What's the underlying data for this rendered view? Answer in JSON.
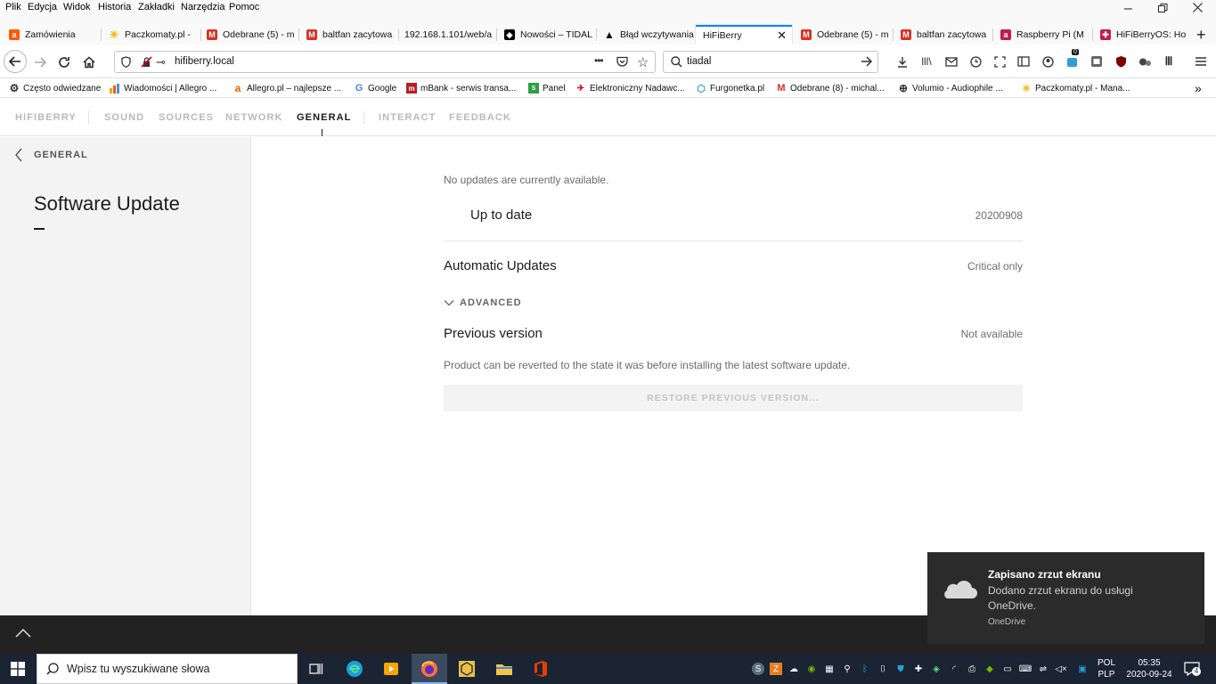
{
  "menubar": {
    "items": [
      "Plik",
      "Edycja",
      "Widok",
      "Historia",
      "Zakładki",
      "Narzędzia",
      "Pomoc"
    ],
    "controls": [
      "minimize-icon",
      "restore-icon",
      "close-icon"
    ]
  },
  "tabs": [
    {
      "title": "Zamówienia",
      "icon": "allegro-icon",
      "color": "#ff5a00"
    },
    {
      "title": "Paczkomaty.pl -",
      "icon": "inpost-icon",
      "color": "#ffcb04"
    },
    {
      "title": "Odebrane (5) - m",
      "icon": "gmail-icon",
      "color": "#d93025"
    },
    {
      "title": "baltfan zacytowa",
      "icon": "gmail-icon",
      "color": "#d93025"
    },
    {
      "title": "192.168.1.101/web/a",
      "icon": "",
      "color": ""
    },
    {
      "title": "Nowości – TIDAL",
      "icon": "tidal-icon",
      "color": "#000000"
    },
    {
      "title": "Błąd wczytywania",
      "icon": "warning-icon",
      "color": "#111111"
    },
    {
      "title": "HiFiBerry",
      "icon": "",
      "color": "",
      "active": true
    },
    {
      "title": "Odebrane (5) - m",
      "icon": "gmail-icon",
      "color": "#d93025"
    },
    {
      "title": "baltfan zacytowa",
      "icon": "gmail-icon",
      "color": "#d93025"
    },
    {
      "title": "Raspberry Pi (M",
      "icon": "raspberry-icon",
      "color": "#c51a4a"
    },
    {
      "title": "HiFiBerryOS: Ho",
      "icon": "hifiberry-icon",
      "color": "#c51a4a"
    }
  ],
  "navbar": {
    "url": "hifiberry.local",
    "search_value": "tiadal",
    "badge_count": "0",
    "more_label": "•••"
  },
  "bookmarks": [
    {
      "label": "Często odwiedzane",
      "icon": "gear-icon"
    },
    {
      "label": "Wiadomości | Allegro ...",
      "icon": "chart-icon"
    },
    {
      "label": "Allegro.pl – najlepsze ...",
      "icon": "allegro-icon"
    },
    {
      "label": "Google",
      "icon": "google-icon"
    },
    {
      "label": "mBank - serwis transa...",
      "icon": "mbank-icon"
    },
    {
      "label": "Panel",
      "icon": "panel-icon"
    },
    {
      "label": "Elektroniczny Nadawc...",
      "icon": "post-icon"
    },
    {
      "label": "Furgonetka.pl",
      "icon": "box-icon"
    },
    {
      "label": "Odebrane (8) - michal...",
      "icon": "gmail-icon"
    },
    {
      "label": "Volumio - Audiophile ...",
      "icon": "globe-icon"
    },
    {
      "label": "Paczkomaty.pl - Mana...",
      "icon": "inpost-icon"
    }
  ],
  "app": {
    "brand": "HIFIBERRY",
    "nav": [
      "SOUND",
      "SOURCES",
      "NETWORK",
      "GENERAL",
      "INTERACT",
      "FEEDBACK"
    ],
    "active_nav": "GENERAL",
    "back_label": "GENERAL",
    "page_title": "Software Update",
    "no_updates_text": "No updates are currently available.",
    "status_label": "Up to date",
    "version": "20200908",
    "auto_updates_label": "Automatic Updates",
    "auto_updates_value": "Critical only",
    "advanced_label": "ADVANCED",
    "previous_version_label": "Previous version",
    "previous_version_value": "Not available",
    "revert_description": "Product can be reverted to the state it was before installing the latest software update.",
    "restore_button": "RESTORE PREVIOUS VERSION..."
  },
  "toast": {
    "title": "Zapisano zrzut ekranu",
    "body": "Dodano zrzut ekranu do usługi OneDrive.",
    "source": "OneDrive"
  },
  "taskbar": {
    "search_placeholder": "Wpisz tu wyszukiwane słowa",
    "lang_top": "POL",
    "lang_bottom": "PLP",
    "time": "05:35",
    "date": "2020-09-24",
    "notification_count": "4"
  }
}
